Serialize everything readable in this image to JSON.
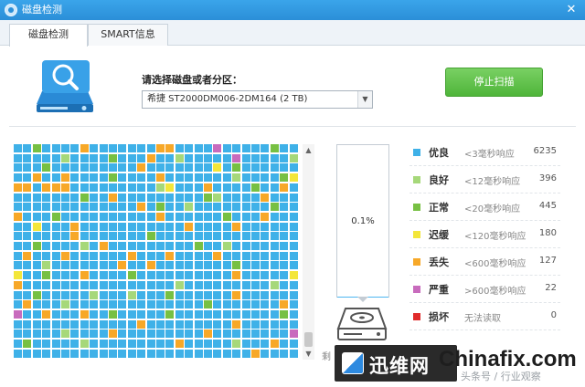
{
  "window": {
    "title": "磁盘检测",
    "close": "✕"
  },
  "tabs": [
    {
      "label": "磁盘检测",
      "active": true
    },
    {
      "label": "SMART信息",
      "active": false
    }
  ],
  "disk_selector": {
    "label": "请选择磁盘或者分区：",
    "value": "希捷 ST2000DM006-2DM164  (2 TB)"
  },
  "stop_button": {
    "label": "停止扫描",
    "color": "#5cc046"
  },
  "progress": {
    "value": 0.001,
    "text": "0.1%"
  },
  "scan_grid": {
    "columns": 30,
    "rows": 22,
    "palette": {
      "0": "#3fb1e8",
      "1": "#a6d87a",
      "2": "#77c043",
      "3": "#f3e63a",
      "4": "#f7a828",
      "5": "#c86bbd"
    },
    "cells": [
      "002000040000000440000500000200",
      "000001000020004001000005000001",
      "000200000000040000000302000000",
      "004004000020000400000001000023",
      "440444000000000130004000020040",
      "000000020040000000002100004000",
      "000000000000040200100000000200",
      "400020000000000400000020004000",
      "003000400000000000400004000000",
      "000000400000002000000000000000",
      "002000010400000000020010000000",
      "040004000000400040000400000000",
      "000100000004004000000002000000",
      "300200040000200000000004000003",
      "400000000000000001000000000100",
      "002000001000100020000004000000",
      "040001000000000000002000000040",
      "500400040020000020000000000020",
      "000000000000040000000004000000",
      "000001000040000000004000000005",
      "020000010000000004000001000400",
      "000000000000000000000000040000"
    ]
  },
  "legend": [
    {
      "label": "优良",
      "threshold": "<3毫秒响应",
      "count": "6235",
      "color": "#3fb1e8"
    },
    {
      "label": "良好",
      "threshold": "<12毫秒响应",
      "count": "396",
      "color": "#a6d87a"
    },
    {
      "label": "正常",
      "threshold": "<20毫秒响应",
      "count": "445",
      "color": "#77c043"
    },
    {
      "label": "迟缓",
      "threshold": "<120毫秒响应",
      "count": "180",
      "color": "#f3e63a"
    },
    {
      "label": "丢失",
      "threshold": "<600毫秒响应",
      "count": "127",
      "color": "#f7a828"
    },
    {
      "label": "严重",
      "threshold": ">600毫秒响应",
      "count": "22",
      "color": "#c86bbd"
    },
    {
      "label": "损坏",
      "threshold": "无法读取",
      "count": "0",
      "color": "#e02b2b"
    }
  ],
  "partial_text": "剩",
  "watermark": {
    "brand": "迅维网",
    "domain": "Chinafix.com",
    "sub": "头条号 / 行业观察"
  }
}
